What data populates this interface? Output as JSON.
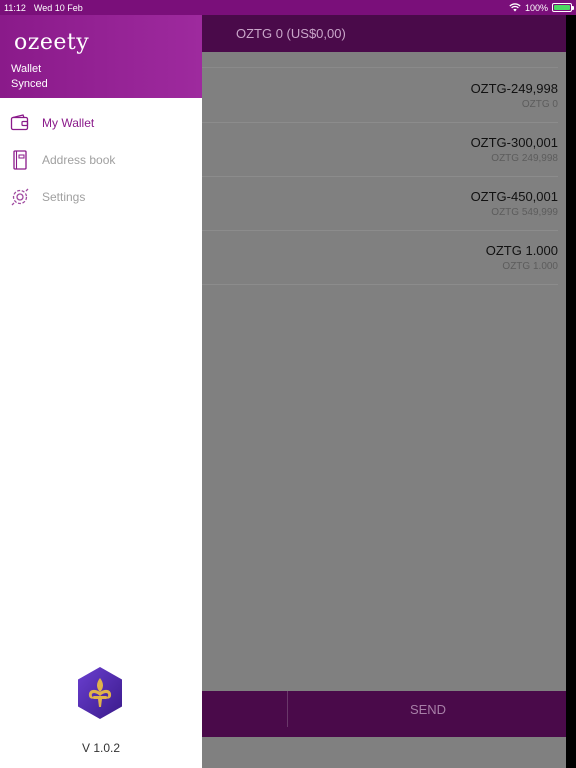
{
  "status": {
    "time": "11:12",
    "date": "Wed 10 Feb",
    "battery": "100%"
  },
  "drawer": {
    "logo": "ozeety",
    "wallet_label": "Wallet",
    "sync_status": "Synced",
    "menu": [
      {
        "label": "My Wallet",
        "icon": "wallet-icon",
        "active": true
      },
      {
        "label": "Address book",
        "icon": "address-book-icon",
        "active": false
      },
      {
        "label": "Settings",
        "icon": "settings-icon",
        "active": false
      }
    ],
    "version": "V 1.0.2"
  },
  "main": {
    "header": "OZTG 0 (US$0,00)",
    "transactions": [
      {
        "amount": "OZTG-249,998",
        "balance": "OZTG 0"
      },
      {
        "amount": "OZTG-300,001",
        "balance": "OZTG 249,998"
      },
      {
        "amount": "OZTG-450,001",
        "balance": "OZTG 549,999"
      },
      {
        "amount": "OZTG 1.000",
        "balance": "OZTG 1.000"
      }
    ],
    "send_label": "SEND"
  },
  "colors": {
    "brand": "#8a1a8a",
    "header_dark": "#4a0a4a"
  }
}
